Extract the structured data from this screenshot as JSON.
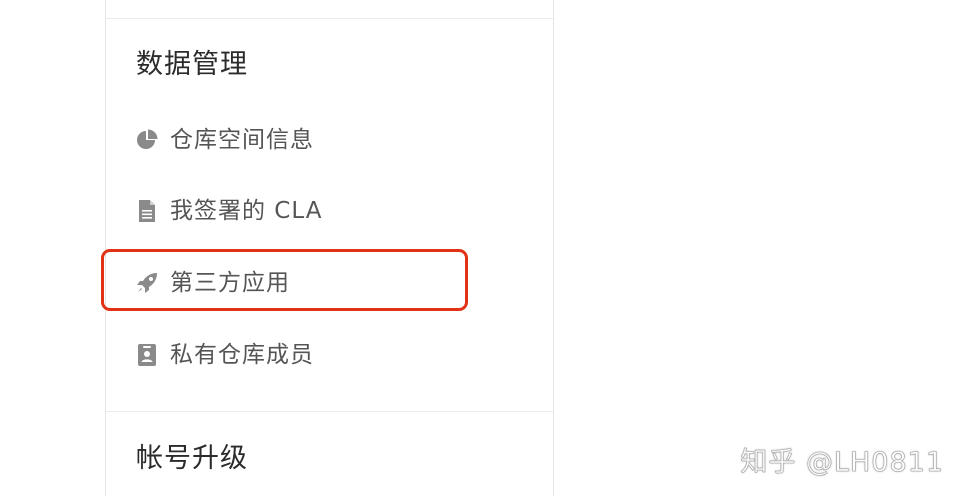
{
  "sections": {
    "data_management": {
      "title": "数据管理",
      "items": [
        {
          "label": "仓库空间信息",
          "icon": "pie-chart-icon"
        },
        {
          "label": "我签署的 CLA",
          "icon": "document-icon"
        },
        {
          "label": "第三方应用",
          "icon": "rocket-icon",
          "highlighted": true
        },
        {
          "label": "私有仓库成员",
          "icon": "badge-icon"
        }
      ]
    },
    "account_upgrade": {
      "title": "帐号升级"
    }
  },
  "watermark": "知乎 @LH0811",
  "colors": {
    "highlight": "#e23215",
    "icon": "#8a8a8a",
    "text": "#555555",
    "title": "#2b2b2b"
  }
}
